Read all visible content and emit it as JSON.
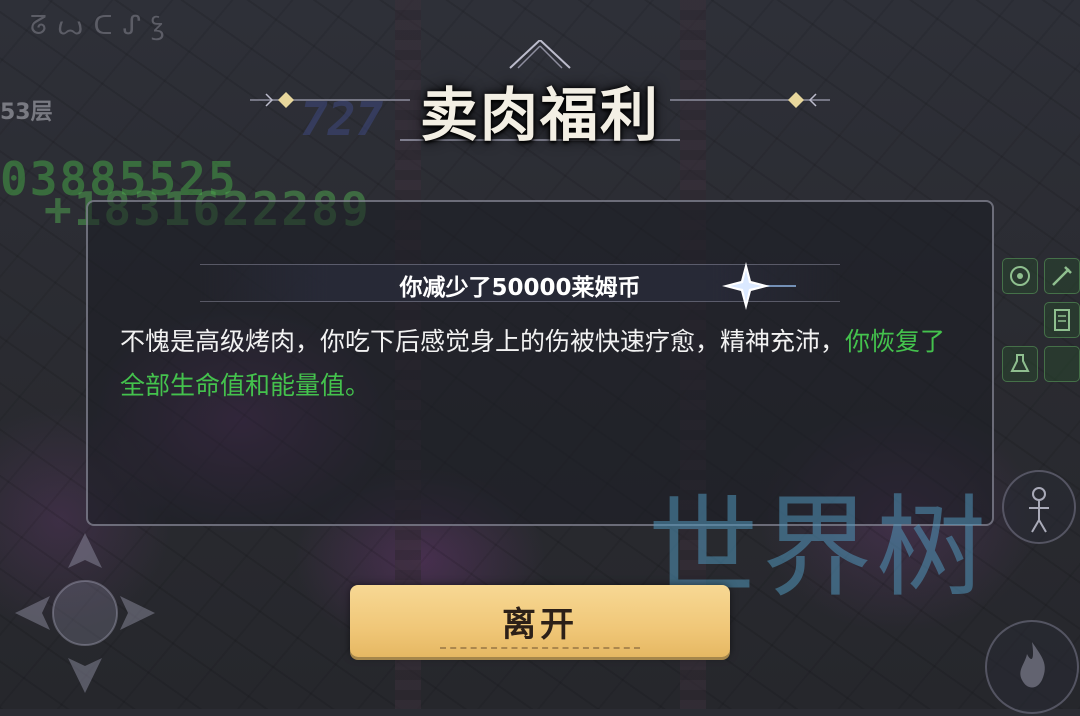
{
  "hud": {
    "floor_label": "53层",
    "runes": "ᘔꙍᑕᔑꝣ",
    "score_total": "03885525",
    "score_gain": "+1831622289",
    "score_mid": "727"
  },
  "dialog": {
    "title": "卖肉福利",
    "headline": "你减少了50000莱姆币",
    "body_plain": "不愧是高级烤肉，你吃下后感觉身上的伤被快速疗愈，精神充沛，",
    "body_highlight": "你恢复了全部生命值和能量值。",
    "leave_button": "离开"
  },
  "watermark": "世界树",
  "colors": {
    "highlight_green": "#44c24d",
    "button_gold": "#f0c778",
    "watermark_blue": "#5096b9"
  },
  "icons": {
    "sparkle": "four-point-star-icon",
    "joystick": "dpad-icon",
    "side": [
      "target-icon",
      "sword-icon",
      "scroll-icon",
      "potion-icon"
    ],
    "corner": [
      "character-icon",
      "flame-icon"
    ]
  }
}
